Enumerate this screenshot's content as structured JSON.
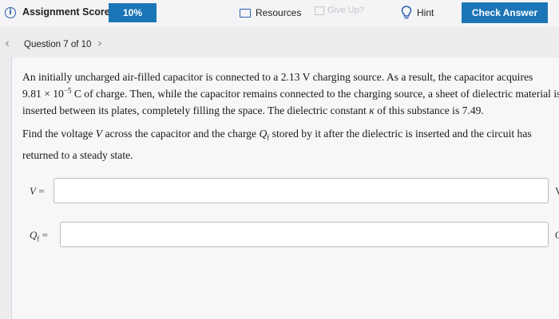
{
  "header": {
    "score_label": "Assignment Score:",
    "score_value": "10%",
    "resources_label": "Resources",
    "giveup_label": "Give Up?",
    "hint_label": "Hint",
    "check_label": "Check Answer"
  },
  "question_nav": {
    "label": "Question 7 of 10",
    "prev": "‹",
    "next": "›"
  },
  "problem": {
    "p1_a": "An initially uncharged air-filled capacitor is connected to a 2.13 V charging source. As a result, the capacitor acquires",
    "p1_b_pre": "9.81 × 10",
    "p1_b_exp": "−5",
    "p1_b_post": " C of charge. Then, while the capacitor remains connected to the charging source, a sheet of dielectric material is",
    "p1_c_pre": "inserted between its plates, completely filling the space. The dielectric constant ",
    "p1_c_kappa": "κ",
    "p1_c_post": " of this substance is 7.49.",
    "p2_a_pre": "Find the voltage ",
    "p2_a_V": "V",
    "p2_a_mid": " across the capacitor and the charge ",
    "p2_a_Q": "Q",
    "p2_a_sub": "f",
    "p2_a_post": " stored by it after the dielectric is inserted and the circuit has",
    "p2_b": "returned to a steady state."
  },
  "answers": {
    "v_label_var": "V",
    "v_label_eq": " =",
    "v_value": "",
    "v_unit": "V",
    "q_label_var": "Q",
    "q_label_sub": "f",
    "q_label_eq": " =",
    "q_value": "",
    "q_unit": "C"
  },
  "colors": {
    "accent": "#1b76b8",
    "icon": "#2a5db0",
    "disabled": "#c4c4c8"
  }
}
